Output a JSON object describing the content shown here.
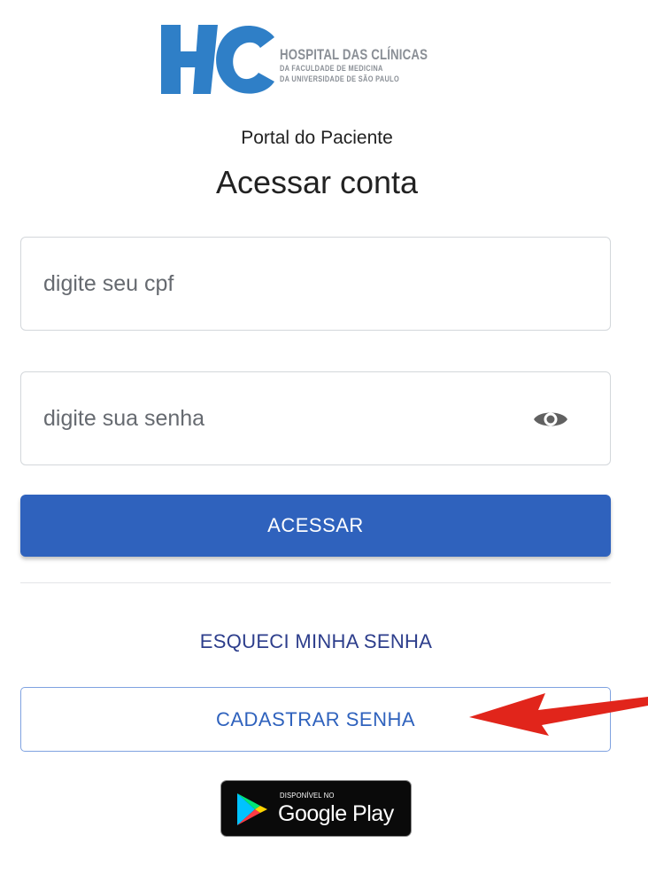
{
  "logo": {
    "mark": "HC",
    "line1": "HOSPITAL DAS CLÍNICAS",
    "line2": "DA FACULDADE DE MEDICINA",
    "line3": "DA UNIVERSIDADE DE SÃO PAULO"
  },
  "header": {
    "subtitle": "Portal do Paciente",
    "title": "Acessar conta"
  },
  "form": {
    "cpf_placeholder": "digite seu cpf",
    "cpf_value": "",
    "password_placeholder": "digite sua senha",
    "password_value": "",
    "password_toggle_icon": "eye-icon",
    "submit_label": "ACESSAR"
  },
  "links": {
    "forgot_password": "ESQUECI MINHA SENHA",
    "register_password": "CADASTRAR SENHA"
  },
  "store_badge": {
    "small_text": "DISPONÍVEL NO",
    "big_text": "Google Play"
  },
  "annotation": {
    "arrow_color": "#e1251b",
    "arrow_icon": "arrow-left-icon"
  },
  "colors": {
    "primary": "#2f62bd",
    "logo_blue": "#2f7fc7",
    "link": "#2d3e8c"
  }
}
